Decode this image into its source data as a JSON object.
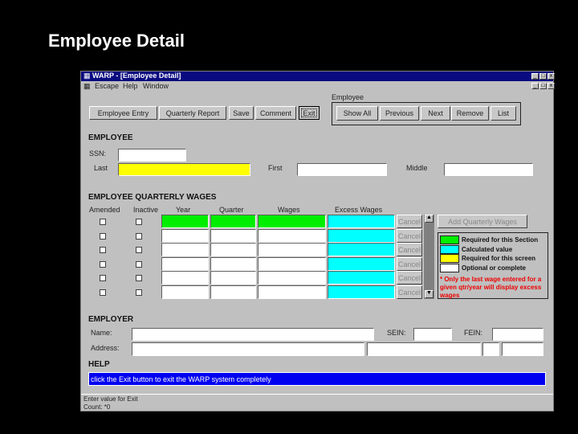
{
  "slide_title": "Employee Detail",
  "window": {
    "title": "WARP - [Employee Detail]",
    "menu": [
      "Escape",
      "Help",
      "Window"
    ]
  },
  "toolbar": [
    "Employee Entry",
    "Quarterly Report",
    "Save",
    "Comment",
    "Exit"
  ],
  "employee_group": {
    "label": "Employee",
    "buttons": [
      "Show All",
      "Previous",
      "Next",
      "Remove",
      "List"
    ]
  },
  "employee": {
    "heading": "EMPLOYEE",
    "ssn_label": "SSN:",
    "last_label": "Last",
    "first_label": "First",
    "middle_label": "Middle"
  },
  "wages": {
    "heading": "EMPLOYEE QUARTERLY WAGES",
    "columns": [
      "Amended",
      "Inactive",
      "Year",
      "Quarter",
      "Wages",
      "Excess Wages"
    ],
    "cancel_label": "Cancel",
    "row_count": 6,
    "add_button": "Add Quarterly Wages"
  },
  "legend": {
    "items": [
      {
        "label": "Required for this Section",
        "color": "#00ee00"
      },
      {
        "label": "Calculated value",
        "color": "#00ffff"
      },
      {
        "label": "Required for this screen",
        "color": "#ffff00"
      },
      {
        "label": "Optional or complete",
        "color": "#ffffff"
      }
    ],
    "note": "* Only the last wage entered for a given qtr/year will display excess wages"
  },
  "employer": {
    "heading": "EMPLOYER",
    "name_label": "Name:",
    "sein_label": "SEIN:",
    "fein_label": "FEIN:",
    "address_label": "Address:"
  },
  "help": {
    "heading": "HELP",
    "text": "click the Exit button to exit the WARP system completely"
  },
  "status": {
    "line1": "Enter value for Exit",
    "line2": "Count: *0"
  }
}
